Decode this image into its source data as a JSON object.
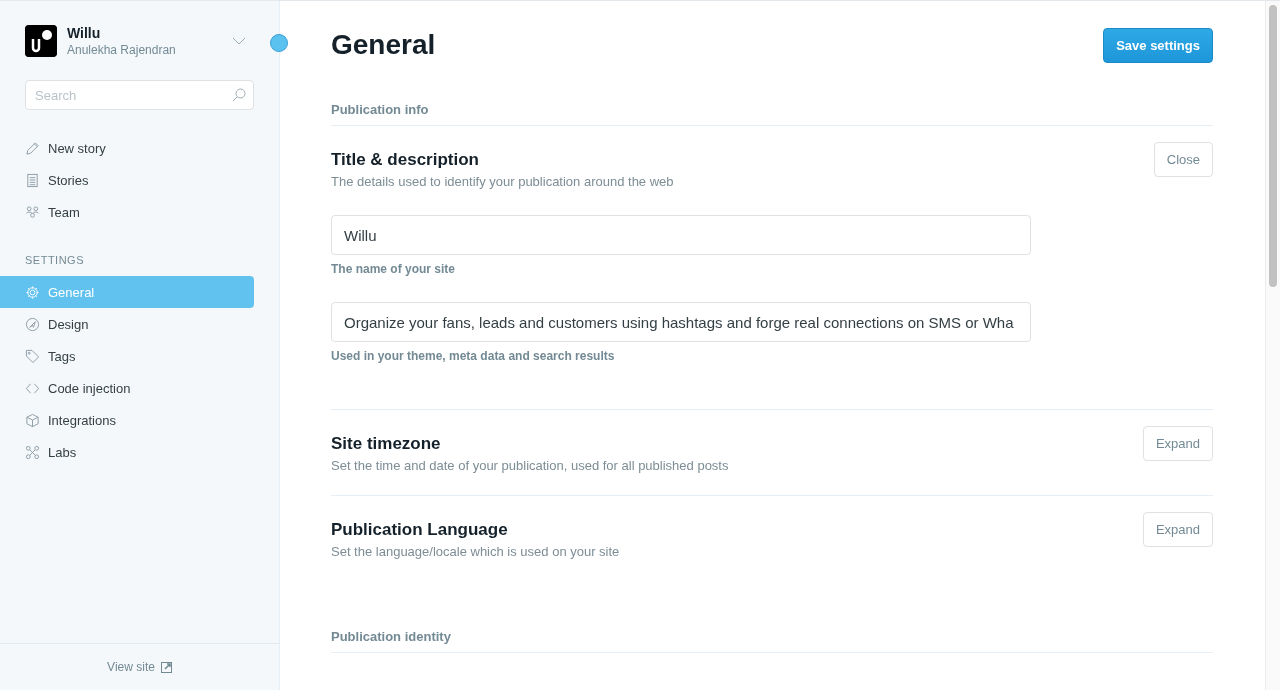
{
  "sidebar": {
    "blog_name": "Willu",
    "user_name": "Anulekha Rajendran",
    "search": {
      "placeholder": "Search"
    },
    "nav_items": [
      {
        "label": "New story",
        "selected": false
      },
      {
        "label": "Stories",
        "selected": false
      },
      {
        "label": "Team",
        "selected": false
      }
    ],
    "settings_heading": "SETTINGS",
    "settings_items": [
      {
        "label": "General",
        "selected": true
      },
      {
        "label": "Design",
        "selected": false
      },
      {
        "label": "Tags",
        "selected": false
      },
      {
        "label": "Code injection",
        "selected": false
      },
      {
        "label": "Integrations",
        "selected": false
      },
      {
        "label": "Labs",
        "selected": false
      }
    ],
    "view_site": "View site"
  },
  "page": {
    "title": "General",
    "save_button": "Save settings",
    "groups": [
      {
        "heading": "Publication info",
        "sections": [
          {
            "title": "Title & description",
            "description": "The details used to identify your publication around the web",
            "button": "Close",
            "fields": [
              {
                "value": "Willu",
                "hint": "The name of your site"
              },
              {
                "value": "Organize your fans, leads and customers using hashtags and forge real connections on SMS or Wha",
                "hint": "Used in your theme, meta data and search results"
              }
            ]
          },
          {
            "title": "Site timezone",
            "description": "Set the time and date of your publication, used for all published posts",
            "button": "Expand"
          },
          {
            "title": "Publication Language",
            "description": "Set the language/locale which is used on your site",
            "button": "Expand"
          }
        ]
      },
      {
        "heading": "Publication identity"
      }
    ]
  }
}
